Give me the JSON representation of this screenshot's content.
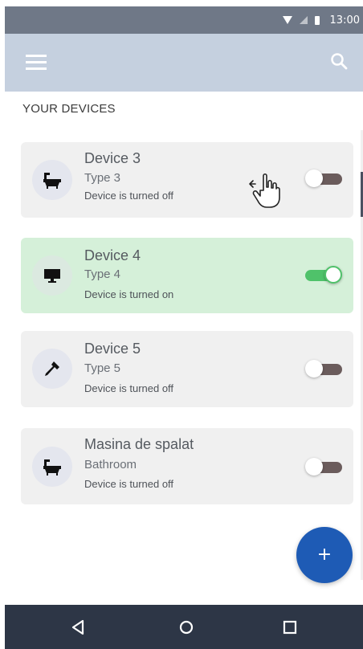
{
  "status_bar": {
    "time": "13:00",
    "icons": [
      "wifi-icon",
      "signal-icon",
      "battery-icon"
    ]
  },
  "app_bar": {
    "menu_icon": "hamburger-menu-icon",
    "search_icon": "search-icon"
  },
  "section_title": "YOUR DEVICES",
  "devices": [
    {
      "name": "Device 3",
      "type": "Type 3",
      "status": "Device is turned off",
      "icon": "bathtub-icon",
      "on": false
    },
    {
      "name": "Device 4",
      "type": "Type 4",
      "status": "Device is turned on",
      "icon": "monitor-icon",
      "on": true
    },
    {
      "name": "Device 5",
      "type": "Type 5",
      "status": "Device is turned off",
      "icon": "hammer-icon",
      "on": false
    },
    {
      "name": "Masina de spalat",
      "type": "Bathroom",
      "status": "Device is turned off",
      "icon": "bathtub-icon",
      "on": false
    }
  ],
  "fab": {
    "label": "+"
  },
  "nav_bar": {
    "back_icon": "back-triangle-icon",
    "home_icon": "home-circle-icon",
    "recents_icon": "recents-square-icon"
  },
  "colors": {
    "status_bar": "#6f7887",
    "app_bar": "#c5d0df",
    "card_off": "#f0f0f0",
    "card_on": "#d5f0d9",
    "toggle_on": "#4fc26a",
    "toggle_off_track": "#6b5c5c",
    "fab": "#1e5bb5",
    "nav_bar": "#2d3646"
  }
}
